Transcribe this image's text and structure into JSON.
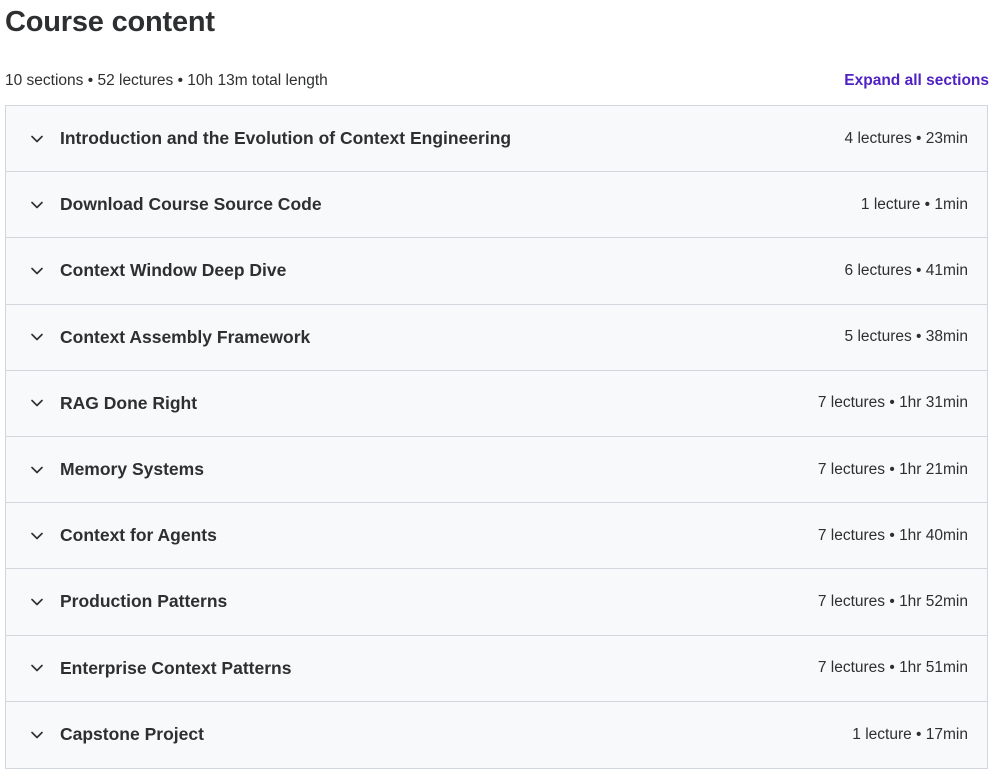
{
  "header": {
    "title": "Course content"
  },
  "summary": {
    "text": "10 sections • 52 lectures • 10h 13m total length",
    "expand_label": "Expand all sections"
  },
  "colors": {
    "accent": "#5022c3",
    "section_bg": "#f7f9fa",
    "border": "#d1d7dc",
    "text": "#2d2f31"
  },
  "sections": [
    {
      "title": "Introduction and the Evolution of Context Engineering",
      "meta": "4 lectures • 23min",
      "icon": "chevron-down-icon"
    },
    {
      "title": "Download Course Source Code",
      "meta": "1 lecture • 1min",
      "icon": "chevron-down-icon"
    },
    {
      "title": "Context Window Deep Dive",
      "meta": "6 lectures • 41min",
      "icon": "chevron-down-icon"
    },
    {
      "title": "Context Assembly Framework",
      "meta": "5 lectures • 38min",
      "icon": "chevron-down-icon"
    },
    {
      "title": "RAG Done Right",
      "meta": "7 lectures • 1hr 31min",
      "icon": "chevron-down-icon"
    },
    {
      "title": "Memory Systems",
      "meta": "7 lectures • 1hr 21min",
      "icon": "chevron-down-icon"
    },
    {
      "title": "Context for Agents",
      "meta": "7 lectures • 1hr 40min",
      "icon": "chevron-down-icon"
    },
    {
      "title": "Production Patterns",
      "meta": "7 lectures • 1hr 52min",
      "icon": "chevron-down-icon"
    },
    {
      "title": "Enterprise Context Patterns",
      "meta": "7 lectures • 1hr 51min",
      "icon": "chevron-down-icon"
    },
    {
      "title": "Capstone Project",
      "meta": "1 lecture • 17min",
      "icon": "chevron-down-icon"
    }
  ]
}
